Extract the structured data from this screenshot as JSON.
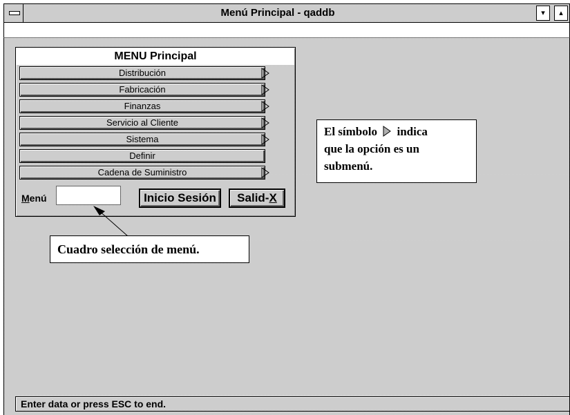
{
  "window": {
    "title": "Menú Principal - qaddb",
    "min_glyph": "▾",
    "max_glyph": "▴"
  },
  "menu": {
    "title": "MENU Principal",
    "items": [
      {
        "label": "Distribución",
        "submenu": true
      },
      {
        "label": "Fabricación",
        "submenu": true
      },
      {
        "label": "Finanzas",
        "submenu": true
      },
      {
        "label": "Servicio al Cliente",
        "submenu": true
      },
      {
        "label": "Sistema",
        "submenu": true
      },
      {
        "label": "Definir",
        "submenu": false
      },
      {
        "label": "Cadena de Suministro",
        "submenu": true
      }
    ],
    "input_label_underlined": "M",
    "input_label_rest": "enú",
    "input_value": "",
    "login_label": "Inicio Sesión",
    "exit_label_main": "Salid-",
    "exit_label_underlined": "X"
  },
  "callouts": {
    "submenu_line1_before": "El símbolo",
    "submenu_line1_after": "indica",
    "submenu_line2": "que la opción es un",
    "submenu_line3": "submenú.",
    "menu_box": "Cuadro selección de menú."
  },
  "status": {
    "text": "Enter data or press ESC to end."
  },
  "colors": {
    "background": "#d8d8d8",
    "text": "#000000"
  },
  "icons": {
    "submenu_arrow": "triangle-right-outline",
    "system_menu": "dash-bar",
    "minimize": "triangle-down",
    "maximize": "triangle-up"
  }
}
